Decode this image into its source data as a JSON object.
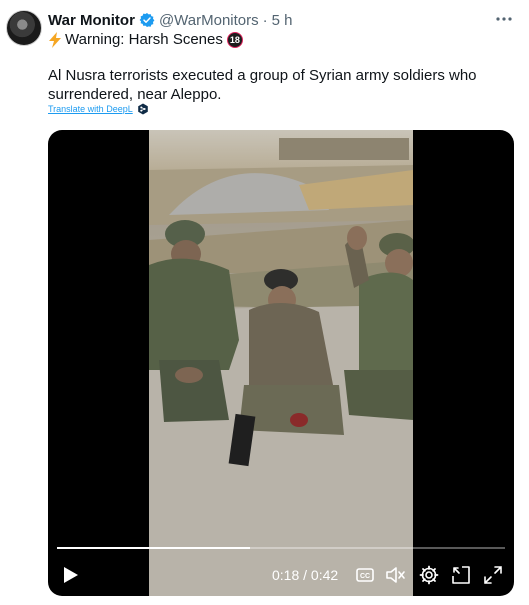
{
  "tweet": {
    "author_name": "War Monitor",
    "handle": "@WarMonitors",
    "separator": "·",
    "timestamp": "5 h",
    "warning": "Warning: Harsh Scenes",
    "age_badge": "18",
    "text": "Al Nusra terrorists executed a group of Syrian army soldiers who surrendered, near Aleppo.",
    "translate_link": "Translate with DeepL"
  },
  "video": {
    "current_time": "0:18",
    "duration": "0:42",
    "time_separator": "/",
    "progress": 0.43,
    "captions_label": "CC"
  },
  "colors": {
    "verified": "#1d9bf0",
    "link": "#1d9bf0",
    "bolt": "#f5a623",
    "age_ring": "#e0245e"
  },
  "icons": [
    "verified-badge-icon",
    "more-options-icon",
    "lightning-icon",
    "age-18-icon",
    "deepl-icon",
    "play-icon",
    "captions-icon",
    "mute-icon",
    "settings-gear-icon",
    "pip-icon",
    "fullscreen-icon"
  ]
}
